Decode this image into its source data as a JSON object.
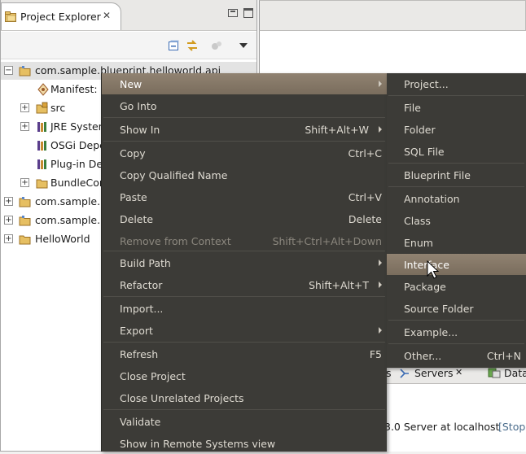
{
  "project_explorer": {
    "title": "Project Explorer",
    "close_glyph": "✕",
    "toolbar_icons": [
      "collapse-all-icon",
      "link-with-editor-icon",
      "filter-icon",
      "view-menu-icon"
    ],
    "tree": [
      {
        "label": "com.sample.blueprint.helloworld.api",
        "expander": "−",
        "icon": "project-folder-icon"
      },
      {
        "label": "Manifest: c",
        "expander": "",
        "icon": "manifest-icon"
      },
      {
        "label": "src",
        "expander": "+",
        "icon": "source-folder-icon"
      },
      {
        "label": "JRE System",
        "expander": "+",
        "icon": "library-icon"
      },
      {
        "label": "OSGi Depe",
        "expander": "",
        "icon": "library-icon"
      },
      {
        "label": "Plug-in Dep",
        "expander": "",
        "icon": "library-icon"
      },
      {
        "label": "BundleCor",
        "expander": "+",
        "icon": "folder-icon"
      },
      {
        "label": "com.sample.b",
        "expander": "+",
        "icon": "project-folder-icon"
      },
      {
        "label": "com.sample.b",
        "expander": "+",
        "icon": "project-folder-icon"
      },
      {
        "label": "HelloWorld",
        "expander": "+",
        "icon": "project-folder-icon"
      }
    ]
  },
  "bottom_panel": {
    "tab_partial": "s",
    "servers_tab": "Servers",
    "servers_close": "✕",
    "data_tab": "Data",
    "server_line": "3.0 Server at localhost",
    "server_status": "[Stop"
  },
  "context_menu": {
    "items": [
      {
        "label": "New",
        "accel": "",
        "submenu": true,
        "highlighted": true
      },
      {
        "label": "Go Into",
        "accel": ""
      },
      {
        "label": "Show In",
        "accel": "Shift+Alt+W",
        "submenu": true
      },
      {
        "label": "Copy",
        "accel": "Ctrl+C"
      },
      {
        "label": "Copy Qualified Name",
        "accel": ""
      },
      {
        "label": "Paste",
        "accel": "Ctrl+V"
      },
      {
        "label": "Delete",
        "accel": "Delete"
      },
      {
        "label": "Remove from Context",
        "accel": "Shift+Ctrl+Alt+Down",
        "disabled": true
      },
      {
        "label": "Build Path",
        "accel": "",
        "submenu": true
      },
      {
        "label": "Refactor",
        "accel": "Shift+Alt+T",
        "submenu": true
      },
      {
        "label": "Import...",
        "accel": ""
      },
      {
        "label": "Export",
        "accel": "",
        "submenu": true
      },
      {
        "label": "Refresh",
        "accel": "F5"
      },
      {
        "label": "Close Project",
        "accel": ""
      },
      {
        "label": "Close Unrelated Projects",
        "accel": ""
      },
      {
        "label": "Validate",
        "accel": ""
      },
      {
        "label": "Show in Remote Systems view",
        "accel": ""
      }
    ]
  },
  "new_submenu": {
    "items": [
      {
        "label": "Project...",
        "accel": ""
      },
      {
        "label": "File",
        "accel": ""
      },
      {
        "label": "Folder",
        "accel": ""
      },
      {
        "label": "SQL File",
        "accel": ""
      },
      {
        "label": "Blueprint File",
        "accel": ""
      },
      {
        "label": "Annotation",
        "accel": ""
      },
      {
        "label": "Class",
        "accel": ""
      },
      {
        "label": "Enum",
        "accel": ""
      },
      {
        "label": "Interface",
        "accel": "",
        "highlighted": true
      },
      {
        "label": "Package",
        "accel": ""
      },
      {
        "label": "Source Folder",
        "accel": ""
      },
      {
        "label": "Example...",
        "accel": ""
      },
      {
        "label": "Other...",
        "accel": "Ctrl+N"
      }
    ]
  },
  "colors": {
    "menu_bg": "#3c3b37",
    "menu_text": "#dfdbd2",
    "menu_highlight": "#857767",
    "disabled_text": "#8b877e"
  }
}
